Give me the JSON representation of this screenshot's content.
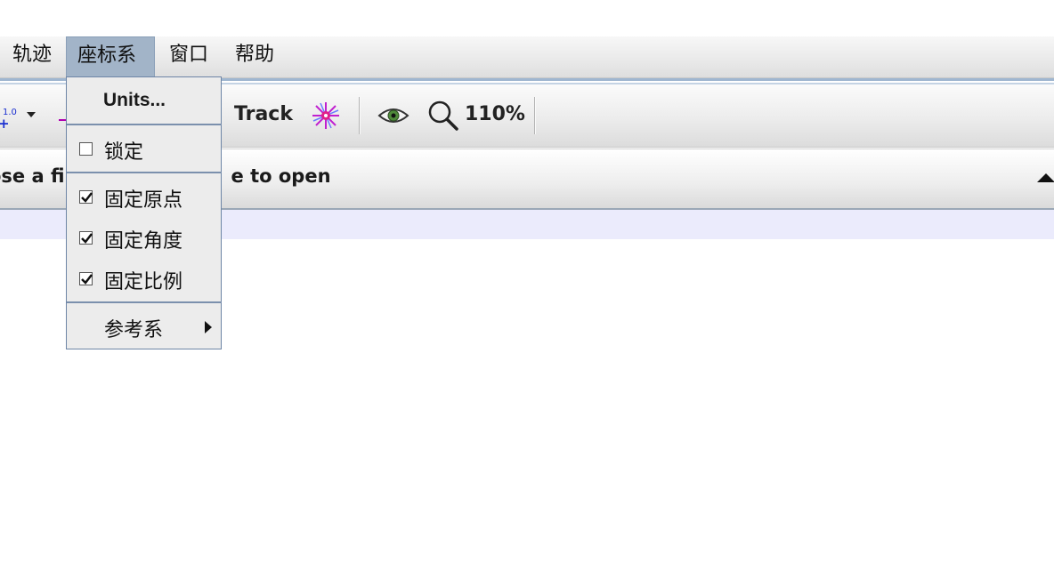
{
  "menubar": {
    "items": [
      {
        "label": "轨迹"
      },
      {
        "label": "座标系"
      },
      {
        "label": "窗口"
      },
      {
        "label": "帮助"
      }
    ],
    "active_index": 1
  },
  "toolbar": {
    "scale_tick_label": "1.0",
    "track_label": "Track",
    "zoom_level": "110%",
    "icons": [
      "axes-scale-icon",
      "dropdown-arrow-icon",
      "pink-line-icon",
      "star-burst-icon",
      "eye-icon",
      "magnifier-icon"
    ]
  },
  "filebar": {
    "text_left": "ose a fi",
    "text_right": "e to open"
  },
  "coord_menu": {
    "units_label": "Units...",
    "lock_label": "锁定",
    "lock_checked": false,
    "fix_origin_label": "固定原点",
    "fix_origin_checked": true,
    "fix_angle_label": "固定角度",
    "fix_angle_checked": true,
    "fix_scale_label": "固定比例",
    "fix_scale_checked": true,
    "reference_frame_label": "参考系"
  },
  "colors": {
    "menu_active_bg": "#a2b4c8",
    "menu_border": "#6d85a6",
    "lavender_strip": "#ebebfc"
  }
}
